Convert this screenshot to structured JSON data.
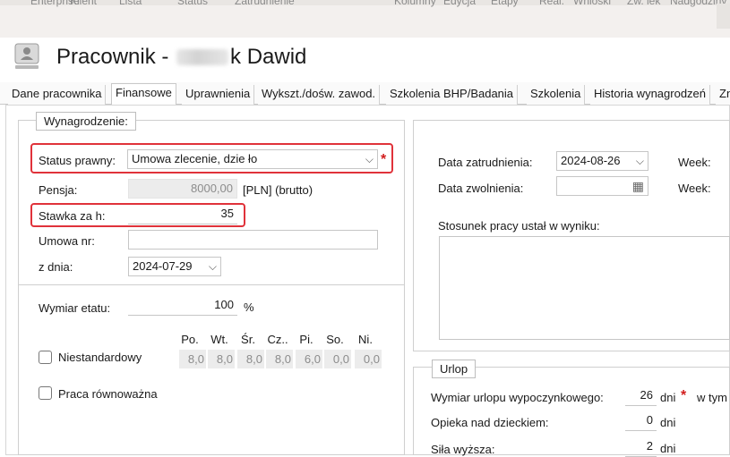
{
  "background_window": {
    "labels": [
      "Enterprise",
      "Klient",
      "Lista",
      "Status",
      "Zatrudnienie",
      "Kolumny",
      "Edycja",
      "Etapy",
      "Real.",
      "Wnioski",
      "Zw. lek",
      "Nadgodziny"
    ]
  },
  "title": {
    "prefix": "Pracownik -",
    "suffix": "k Dawid"
  },
  "tabs": [
    {
      "label": "Dane pracownika"
    },
    {
      "label": "Finansowe"
    },
    {
      "label": "Uprawnienia"
    },
    {
      "label": "Wykszt./dośw. zawod."
    },
    {
      "label": "Szkolenia BHP/Badania"
    },
    {
      "label": "Szkolenia"
    },
    {
      "label": "Historia wynagrodzeń"
    },
    {
      "label": "Zn"
    }
  ],
  "wynagrodzenie": {
    "legend": "Wynagrodzenie:",
    "status_label": "Status prawny:",
    "status_value": "Umowa zlecenie, dzie ło",
    "pensja_label": "Pensja:",
    "pensja_value": "8000,00",
    "pensja_unit": "[PLN] (brutto)",
    "stawka_label": "Stawka za h:",
    "stawka_value": "35",
    "umowa_label": "Umowa nr:",
    "umowa_value": "",
    "zdnia_label": "z dnia:",
    "zdnia_value": "2024-07-29",
    "wymiar_label": "Wymiar etatu:",
    "wymiar_value": "100",
    "wymiar_unit": "%",
    "niestandardowy_label": "Niestandardowy",
    "praca_label": "Praca równoważna",
    "days": [
      {
        "label": "Po.",
        "value": "8,0"
      },
      {
        "label": "Wt.",
        "value": "8,0"
      },
      {
        "label": "Śr.",
        "value": "8,0"
      },
      {
        "label": "Cz..",
        "value": "8,0"
      },
      {
        "label": "Pi.",
        "value": "6,0"
      },
      {
        "label": "So.",
        "value": "0,0"
      },
      {
        "label": "Ni.",
        "value": "0,0"
      }
    ]
  },
  "zatrudnienie": {
    "data_zatr_label": "Data zatrudnienia:",
    "data_zatr_value": "2024-08-26",
    "data_zwol_label": "Data zwolnienia:",
    "data_zwol_value": "",
    "week_label": "Week:",
    "stosunek_label": "Stosunek pracy ustał w wyniku:"
  },
  "urlop": {
    "legend": "Urlop",
    "wymiar_label": "Wymiar urlopu wypoczynkowego:",
    "wymiar_value": "26",
    "wymiar_unit": "dni",
    "wtym_label": "w tym",
    "opieka_label": "Opieka nad dzieckiem:",
    "opieka_value": "0",
    "opieka_unit": "dni",
    "sila_label": "Siła wyższa:",
    "sila_value": "2",
    "sila_unit": "dni"
  },
  "colors": {
    "highlight": "#e0323a",
    "required": "#d21d1d"
  }
}
